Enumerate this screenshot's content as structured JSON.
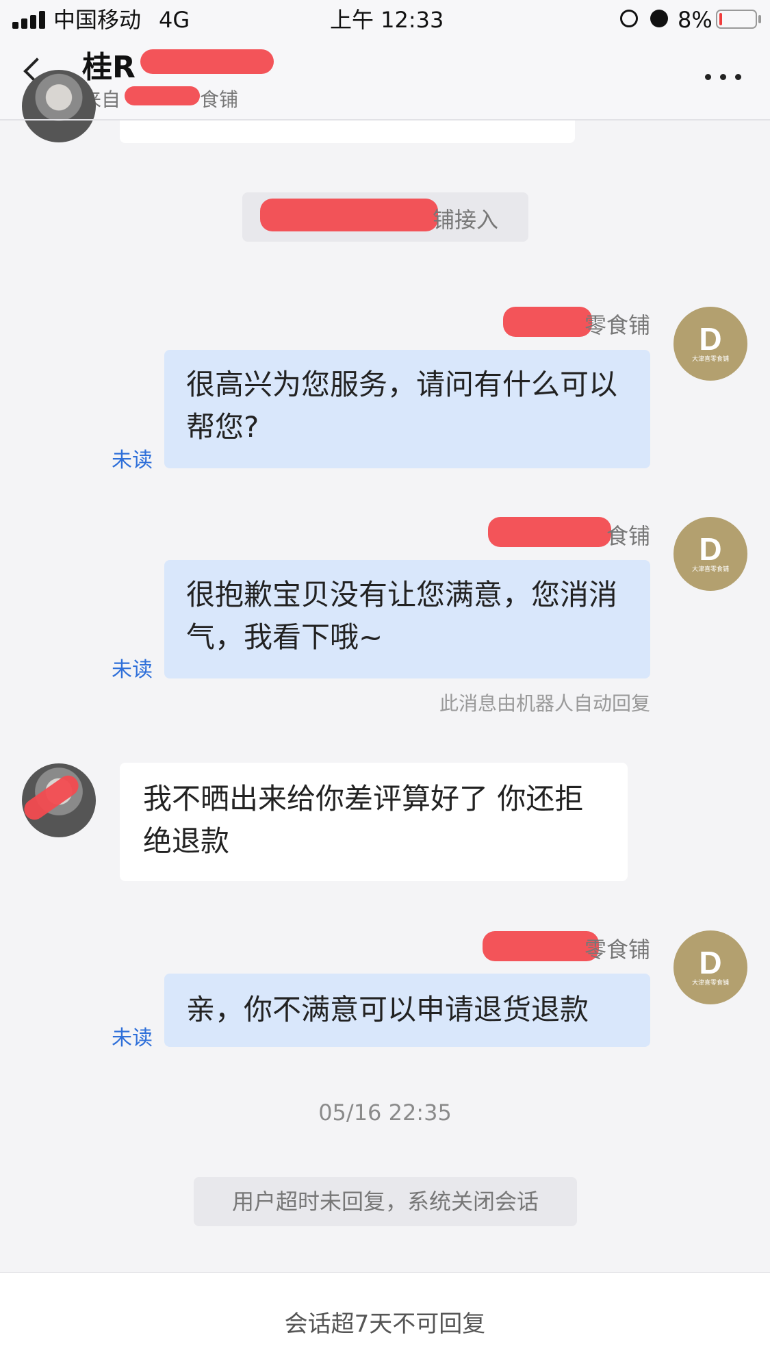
{
  "status_bar": {
    "carrier": "中国移动",
    "network": "4G",
    "time": "上午 12:33",
    "battery": "8%",
    "battery_level": 0.08
  },
  "header": {
    "title": "桂R",
    "subtitle_prefix": "来自",
    "subtitle_suffix": "食铺"
  },
  "messages": {
    "system_join_suffix": "铺接入",
    "shop_name_1": "零食铺",
    "msg1": "很高兴为您服务，请问有什么可以帮您?",
    "shop_name_2": "食铺",
    "msg2": "很抱歉宝贝没有让您满意，您消消气，我看下哦~",
    "auto_reply_note": "此消息由机器人自动回复",
    "user_msg": "我不晒出来给你差评算好了  你还拒绝退款",
    "shop_name_3": "零食铺",
    "msg3": "亲，你不满意可以申请退货退款",
    "unread_label": "未读",
    "timestamp": "05/16 22:35",
    "session_closed": "用户超时未回复，系统关闭会话"
  },
  "avatar": {
    "letter": "D",
    "shop_caption": "大津喜零食铺"
  },
  "footer": {
    "text": "会话超7天不可回复"
  }
}
